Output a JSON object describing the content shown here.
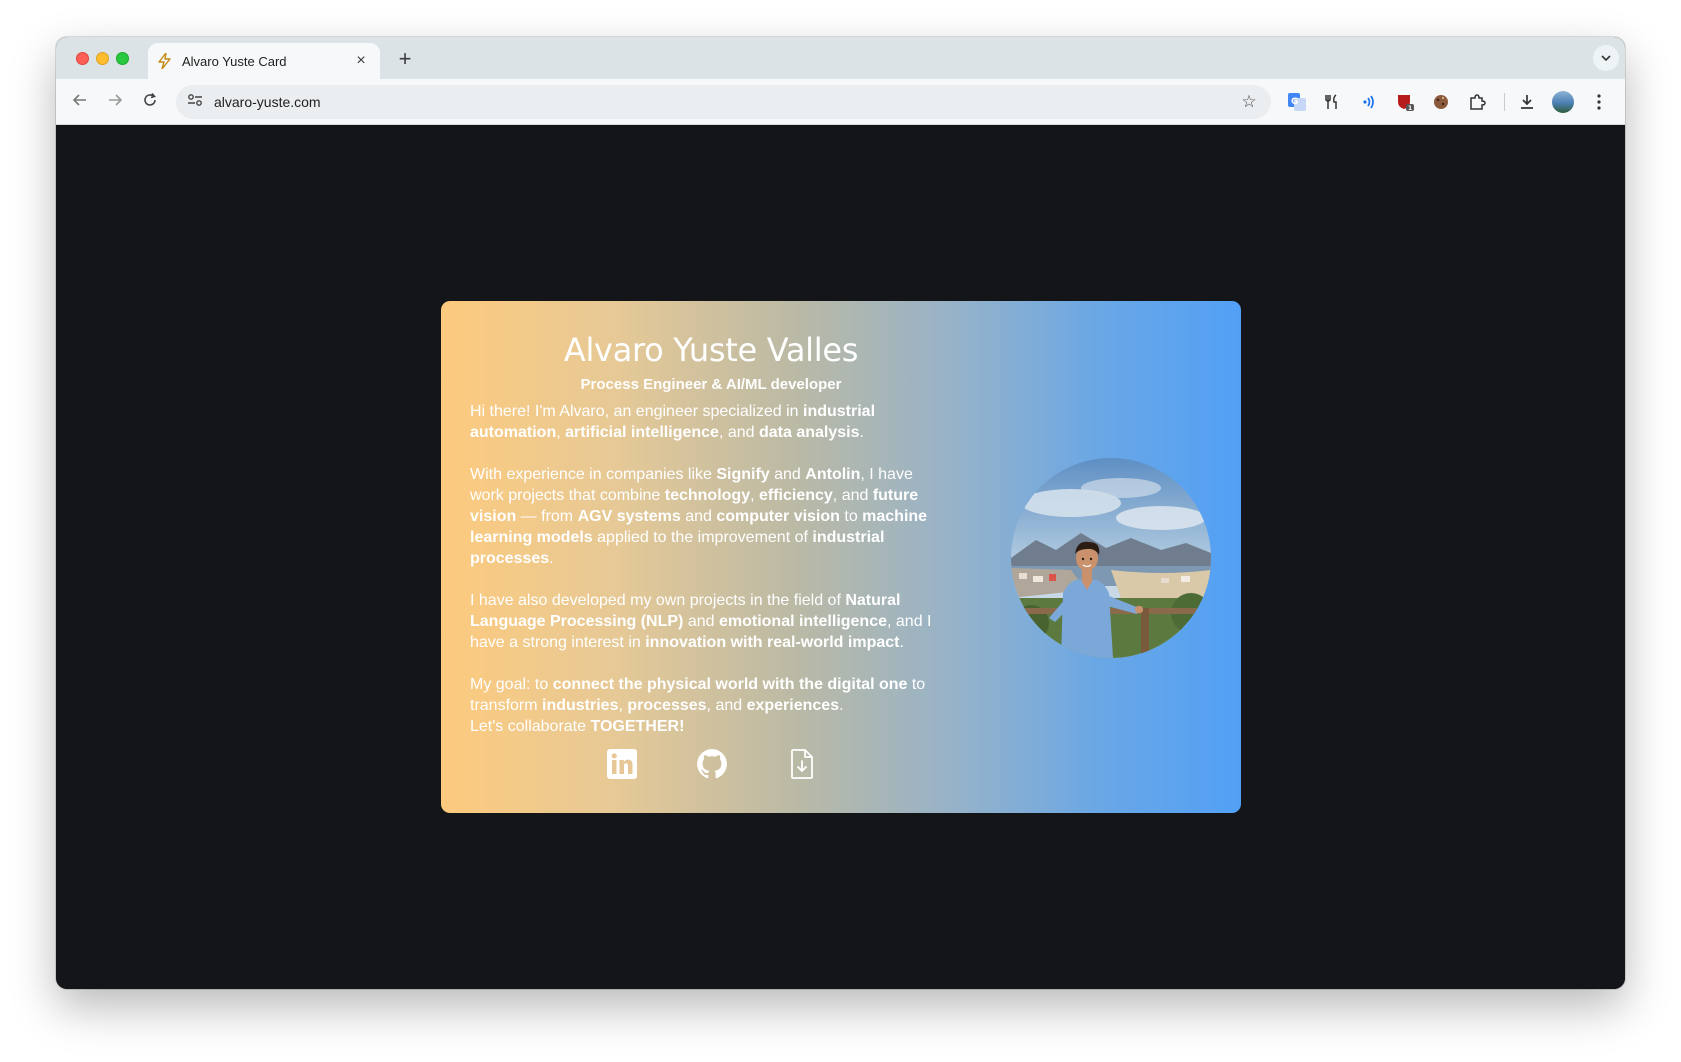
{
  "browser": {
    "tab_title": "Alvaro Yuste Card",
    "tab_close": "×",
    "new_tab": "+",
    "url": "alvaro-yuste.com",
    "tab_menu": "⌄"
  },
  "card": {
    "name": "Alvaro Yuste Valles",
    "role": "Process Engineer & AI/ML developer",
    "bio": [
      [
        {
          "t": "Hi there! I'm Alvaro, an engineer specialized in ",
          "b": false
        },
        {
          "t": "industrial automation",
          "b": true
        },
        {
          "t": ", ",
          "b": false
        },
        {
          "t": "artificial intelligence",
          "b": true
        },
        {
          "t": ", and ",
          "b": false
        },
        {
          "t": "data analysis",
          "b": true
        },
        {
          "t": ".",
          "b": false
        }
      ],
      [
        {
          "t": "With experience in companies like ",
          "b": false
        },
        {
          "t": "Signify",
          "b": true
        },
        {
          "t": " and ",
          "b": false
        },
        {
          "t": "Antolin",
          "b": true
        },
        {
          "t": ", I have work projects that combine ",
          "b": false
        },
        {
          "t": "technology",
          "b": true
        },
        {
          "t": ", ",
          "b": false
        },
        {
          "t": "efficiency",
          "b": true
        },
        {
          "t": ", and ",
          "b": false
        },
        {
          "t": "future vision",
          "b": true
        },
        {
          "t": " — from ",
          "b": false
        },
        {
          "t": "AGV systems",
          "b": true
        },
        {
          "t": " and ",
          "b": false
        },
        {
          "t": "computer vision",
          "b": true
        },
        {
          "t": " to ",
          "b": false
        },
        {
          "t": "machine learning models",
          "b": true
        },
        {
          "t": " applied to the improvement of ",
          "b": false
        },
        {
          "t": "industrial processes",
          "b": true
        },
        {
          "t": ".",
          "b": false
        }
      ],
      [
        {
          "t": "I have also developed my own projects in the field of ",
          "b": false
        },
        {
          "t": "Natural Language Processing (NLP)",
          "b": true
        },
        {
          "t": " and ",
          "b": false
        },
        {
          "t": "emotional intelligence",
          "b": true
        },
        {
          "t": ", and I have a strong interest in ",
          "b": false
        },
        {
          "t": "innovation with real-world impact",
          "b": true
        },
        {
          "t": ".",
          "b": false
        }
      ],
      [
        {
          "t": "My goal: to ",
          "b": false
        },
        {
          "t": "connect the physical world with the digital one",
          "b": true
        },
        {
          "t": " to transform ",
          "b": false
        },
        {
          "t": "industries",
          "b": true
        },
        {
          "t": ", ",
          "b": false
        },
        {
          "t": "processes",
          "b": true
        },
        {
          "t": ", and ",
          "b": false
        },
        {
          "t": "experiences",
          "b": true
        },
        {
          "t": ".",
          "b": false
        },
        {
          "t": "\nLet's collaborate ",
          "b": false
        },
        {
          "t": "TOGETHER!",
          "b": true
        }
      ]
    ],
    "socials": [
      {
        "icon": "linkedin-icon"
      },
      {
        "icon": "github-icon"
      },
      {
        "icon": "download-cv-icon"
      }
    ]
  },
  "colors": {
    "page_bg": "#141518",
    "gradient_start": "#fdca7e",
    "gradient_end": "#52a0f5",
    "text": "#ffffff"
  }
}
